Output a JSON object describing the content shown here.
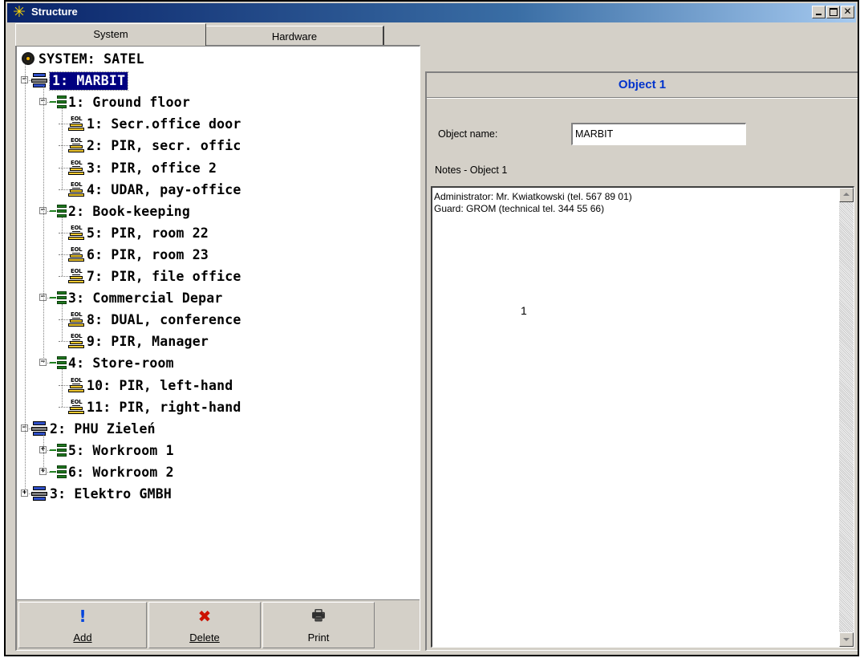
{
  "window": {
    "title": "Structure",
    "icon": "asterisk-icon",
    "controls": [
      "minimize-icon",
      "maximize-icon",
      "close-icon"
    ]
  },
  "tabs": [
    {
      "label": "System",
      "active": true
    },
    {
      "label": "Hardware",
      "active": false
    }
  ],
  "tree": {
    "root": "SYSTEM: SATEL",
    "nodes": [
      {
        "label": "1: MARBIT",
        "type": "object",
        "expanded": true,
        "selected": true
      },
      {
        "label": "1: Ground floor",
        "type": "partition",
        "expanded": true
      },
      {
        "label": "1: Secr.office door",
        "type": "zone"
      },
      {
        "label": "2: PIR, secr. offic",
        "type": "zone"
      },
      {
        "label": "3: PIR, office 2",
        "type": "zone"
      },
      {
        "label": "4: UDAR, pay-office",
        "type": "zone"
      },
      {
        "label": "2: Book-keeping",
        "type": "partition",
        "expanded": true
      },
      {
        "label": "5: PIR, room 22",
        "type": "zone"
      },
      {
        "label": "6: PIR, room 23",
        "type": "zone"
      },
      {
        "label": "7: PIR, file office",
        "type": "zone"
      },
      {
        "label": "3: Commercial Depar",
        "type": "partition",
        "expanded": true
      },
      {
        "label": "8: DUAL, conference",
        "type": "zone"
      },
      {
        "label": "9: PIR, Manager",
        "type": "zone"
      },
      {
        "label": "4: Store-room",
        "type": "partition",
        "expanded": true
      },
      {
        "label": "10: PIR, left-hand",
        "type": "zone"
      },
      {
        "label": "11: PIR, right-hand",
        "type": "zone"
      },
      {
        "label": "2: PHU Zieleń",
        "type": "object",
        "expanded": true
      },
      {
        "label": "5: Workroom 1",
        "type": "partition",
        "expanded": false
      },
      {
        "label": "6: Workroom 2",
        "type": "partition",
        "expanded": false
      },
      {
        "label": "3: Elektro GMBH",
        "type": "object",
        "expanded": false
      }
    ],
    "zone_icon_text": "EOL"
  },
  "toolbar": {
    "add": "Add",
    "delete": "Delete",
    "print": "Print"
  },
  "details": {
    "header": "Object 1",
    "name_label": "Object name:",
    "name_value": "MARBIT",
    "notes_label": "Notes - Object 1",
    "notes_line1": "Administrator: Mr. Kwiatkowski (tel. 567 89 01)",
    "notes_line2": "Guard: GROM (technical tel. 344 55 66)",
    "callout": "1"
  },
  "colors": {
    "titlebar": "#0a246a",
    "selection": "#000080",
    "header_text": "#0033cc",
    "delete_icon": "#cc1100",
    "add_icon": "#0044dd"
  }
}
